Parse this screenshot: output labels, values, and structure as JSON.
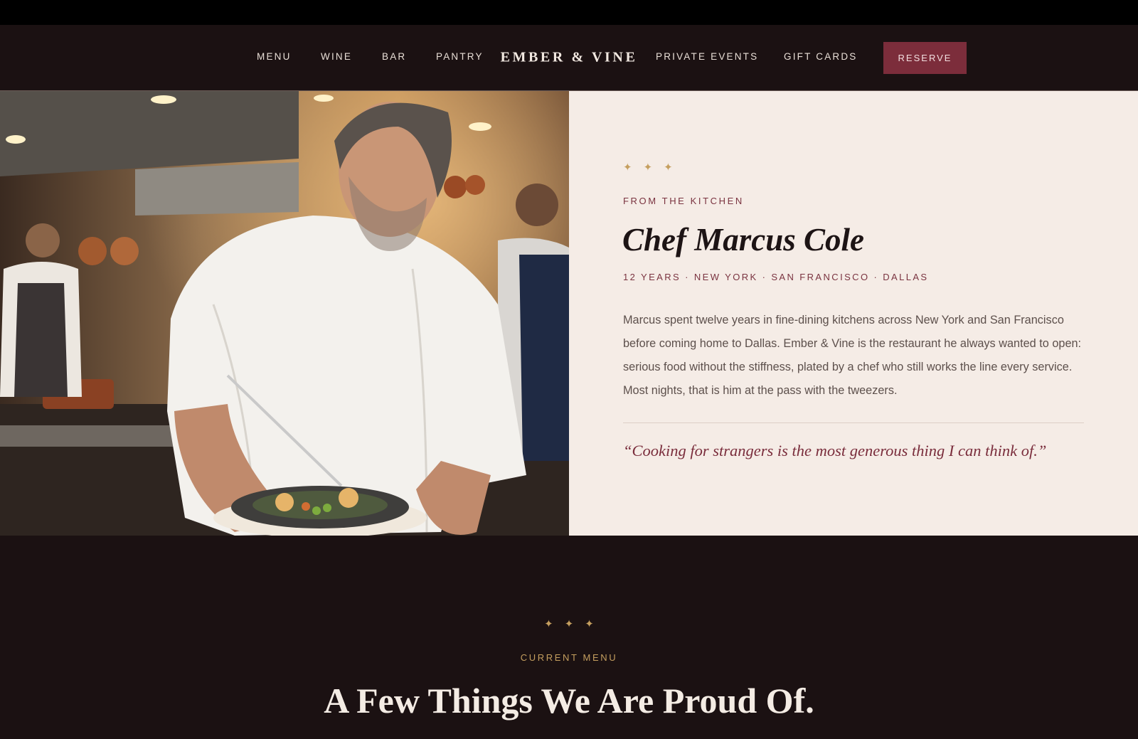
{
  "nav": {
    "left_links": [
      "MENU",
      "WINE",
      "BAR",
      "PANTRY"
    ],
    "brand": "EMBER & VINE",
    "right_links": [
      "PRIVATE EVENTS",
      "GIFT CARDS"
    ],
    "cta": "RESERVE"
  },
  "chef": {
    "stars": "✦✦✦",
    "eyebrow": "FROM THE KITCHEN",
    "name": "Chef Marcus Cole",
    "meta": "12 YEARS · NEW YORK · SAN FRANCISCO · DALLAS",
    "bio": "Marcus spent twelve years in fine-dining kitchens across New York and San Francisco before coming home to Dallas. Ember & Vine is the restaurant he always wanted to open: serious food without the stiffness, plated by a chef who still works the line every service. Most nights, that is him at the pass with the tweezers.",
    "quote": "“Cooking for strangers is the most generous thing I can think of.”"
  },
  "menu_section": {
    "stars": "✦✦✦",
    "eyebrow": "CURRENT MENU",
    "title": "A Few Things We Are Proud Of."
  },
  "colors": {
    "background": "#1b1112",
    "accent": "#7c2d3b",
    "gold": "#c59f5f",
    "cream": "#f5ece6"
  }
}
